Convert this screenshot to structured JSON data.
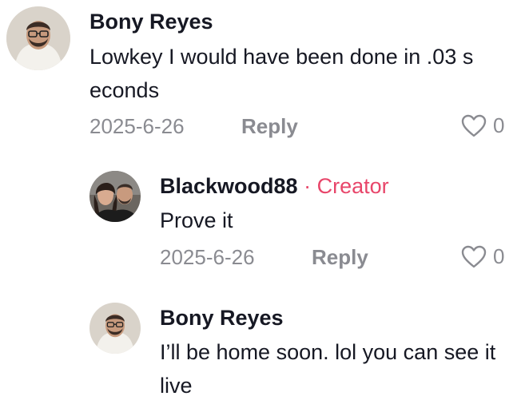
{
  "comments": [
    {
      "username": "Bony Reyes",
      "text": "Lowkey I would have been done in .03 s econds",
      "date": "2025-6-26",
      "reply_label": "Reply",
      "likes": "0"
    },
    {
      "username": "Blackwood88",
      "badge_separator": "·",
      "badge": "Creator",
      "text": "Prove it",
      "date": "2025-6-26",
      "reply_label": "Reply",
      "likes": "0"
    },
    {
      "username": "Bony Reyes",
      "text": "I’ll be home soon. lol you can see it live"
    }
  ],
  "icons": {
    "like": "heart-outline-icon"
  },
  "colors": {
    "creator_badge": "#e8466a",
    "meta_text": "#8a8b91",
    "primary_text": "#161823"
  }
}
